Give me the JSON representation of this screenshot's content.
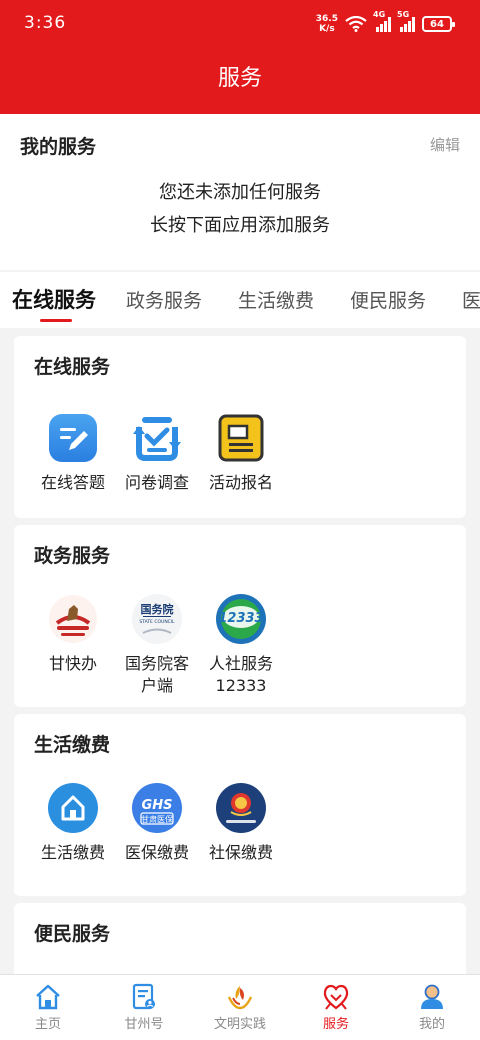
{
  "status": {
    "time": "3:36",
    "speed_value": "36.5",
    "speed_unit": "K/s",
    "net1": "4G",
    "net2": "5G",
    "battery": "64"
  },
  "header": {
    "title": "服务"
  },
  "my_services": {
    "title": "我的服务",
    "edit": "编辑",
    "empty_line1": "您还未添加任何服务",
    "empty_line2": "长按下面应用添加服务"
  },
  "tabs": [
    {
      "label": "在线服务"
    },
    {
      "label": "政务服务"
    },
    {
      "label": "生活缴费"
    },
    {
      "label": "便民服务"
    },
    {
      "label": "医"
    }
  ],
  "sections": {
    "online": {
      "title": "在线服务",
      "apps": [
        {
          "label": "在线答题",
          "icon": "pencil-icon"
        },
        {
          "label": "问卷调查",
          "icon": "survey-icon"
        },
        {
          "label": "活动报名",
          "icon": "signup-icon"
        }
      ]
    },
    "gov": {
      "title": "政务服务",
      "apps": [
        {
          "label": "甘快办",
          "icon": "gankuaiban-icon"
        },
        {
          "label": "国务院客户端",
          "line1": "国务院客",
          "line2": "户端",
          "icon": "state-council-icon",
          "logo_text": "国务院",
          "logo_sub": "STATE COUNCIL"
        },
        {
          "label": "人社服务12333",
          "line1": "人社服务",
          "line2": "12333",
          "icon": "hr-12333-icon",
          "logo_text": "12333"
        }
      ]
    },
    "life": {
      "title": "生活缴费",
      "apps": [
        {
          "label": "生活缴费",
          "icon": "house-icon"
        },
        {
          "label": "医保缴费",
          "icon": "medical-insurance-icon",
          "logo_text": "GHS",
          "logo_sub": "甘肃医保"
        },
        {
          "label": "社保缴费",
          "icon": "tax-emblem-icon"
        }
      ]
    },
    "convenience": {
      "title": "便民服务"
    }
  },
  "nav": [
    {
      "label": "主页",
      "icon": "home-icon"
    },
    {
      "label": "甘州号",
      "icon": "account-icon"
    },
    {
      "label": "文明实践",
      "icon": "civilization-icon"
    },
    {
      "label": "服务",
      "icon": "service-heart-icon"
    },
    {
      "label": "我的",
      "icon": "user-icon"
    }
  ],
  "colors": {
    "brand_red": "#e31a1c",
    "icon_blue": "#2f8de4",
    "text_gray": "#8a8a8a"
  }
}
